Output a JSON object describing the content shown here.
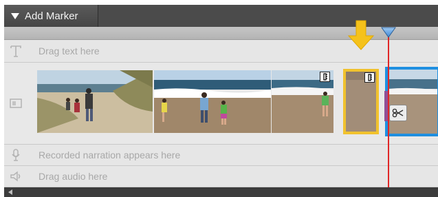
{
  "toolbar": {
    "add_marker_label": "Add Marker"
  },
  "tracks": {
    "text": {
      "hint": "Drag text here",
      "icon": "text-icon"
    },
    "video": {
      "icon": "video-track-icon"
    },
    "narration": {
      "hint": "Recorded narration appears here",
      "icon": "microphone-icon"
    },
    "audio": {
      "hint": "Drag audio here",
      "icon": "speaker-icon"
    }
  },
  "colors": {
    "playhead": "#e12525",
    "selected_clip_border": "#1f8fe0",
    "highlight_clip_border": "#f1c22e",
    "indicator_arrow": "#f5c21b"
  }
}
